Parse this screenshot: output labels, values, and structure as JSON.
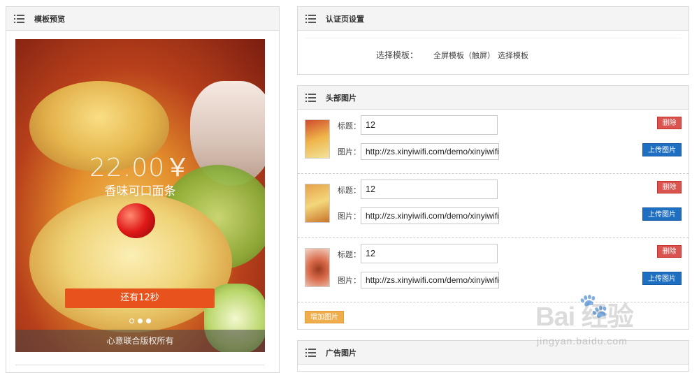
{
  "preview": {
    "title": "模板预览",
    "price": "22.00￥",
    "dish_name": "香味可口面条",
    "countdown": "还有12秒",
    "slide_dots": 3,
    "active_dot": 2,
    "copyright": "心意联合版权所有"
  },
  "auth": {
    "title": "认证页设置",
    "template_label": "选择模板：",
    "template_value": "全屏模板（触屏）",
    "select_link": "选择模板"
  },
  "header_images": {
    "title": "头部图片",
    "title_field_label": "标题：",
    "image_field_label": "图片：",
    "delete_label": "删除",
    "upload_label": "上传图片",
    "add_label": "增加图片",
    "items": [
      {
        "title": "12",
        "url": "http://zs.xinyiwifi.com/demo/xinyiwifi"
      },
      {
        "title": "12",
        "url": "http://zs.xinyiwifi.com/demo/xinyiwifi"
      },
      {
        "title": "12",
        "url": "http://zs.xinyiwifi.com/demo/xinyiwifi"
      }
    ]
  },
  "ad_images": {
    "title": "广告图片"
  },
  "watermark": {
    "logo": "Bai  经验",
    "url": "jingyan.baidu.com"
  }
}
